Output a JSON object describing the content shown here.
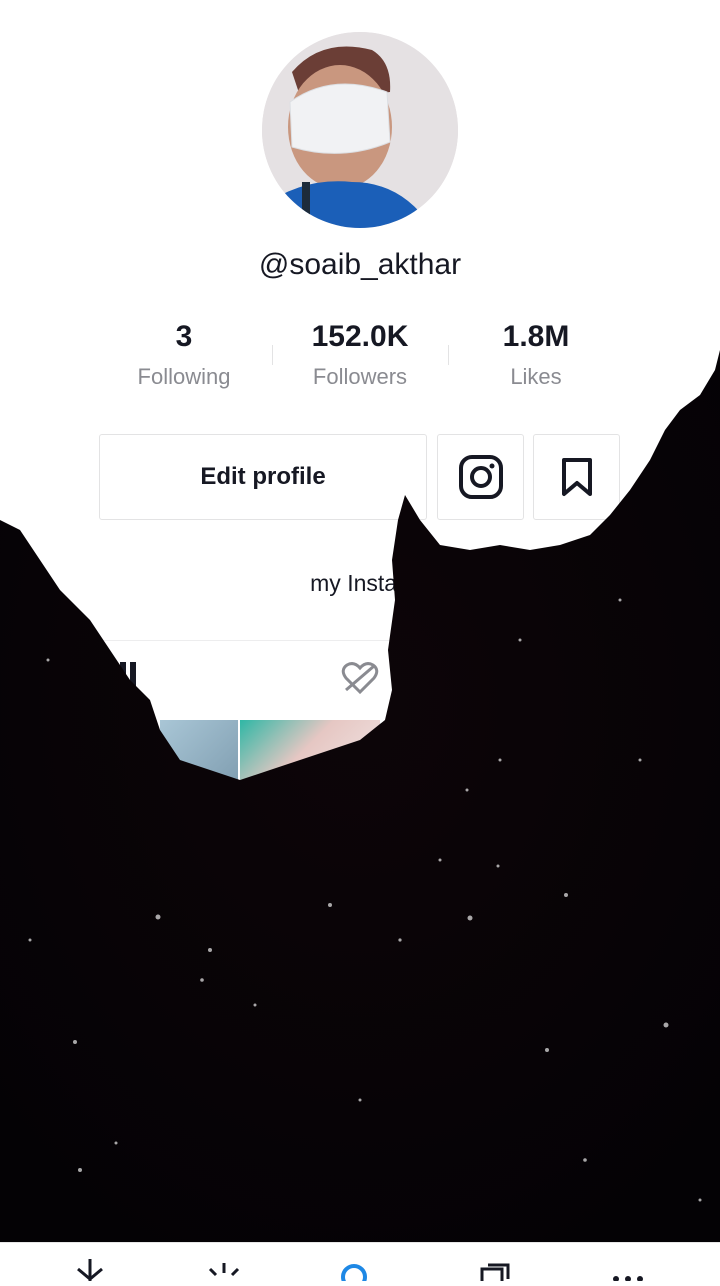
{
  "profile": {
    "username": "@soaib_akthar",
    "bio": "my Instag"
  },
  "stats": {
    "following_count": "3",
    "following_label": "Following",
    "followers_count": "152.0K",
    "followers_label": "Followers",
    "likes_count": "1.8M",
    "likes_label": "Likes"
  },
  "actions": {
    "edit_profile_label": "Edit profile",
    "instagram_icon": "instagram-icon",
    "bookmark_icon": "bookmark-icon"
  },
  "tabs": {
    "videos_icon": "grid-icon",
    "liked_icon": "hidden-heart-icon"
  },
  "bottom_nav": {
    "icons": [
      "download-icon",
      "sparkle-icon",
      "search-icon",
      "copy-icon",
      "more-icon"
    ],
    "active_color": "#1e88e5"
  },
  "colors": {
    "text_primary": "#161823",
    "text_secondary": "#8a8b91",
    "border": "#e3e3e4"
  }
}
